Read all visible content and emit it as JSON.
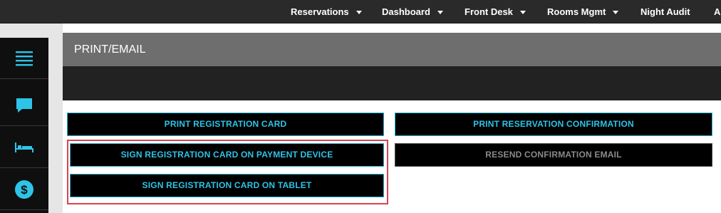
{
  "nav": {
    "items": [
      {
        "label": "Reservations",
        "dropdown": true
      },
      {
        "label": "Dashboard",
        "dropdown": true
      },
      {
        "label": "Front Desk",
        "dropdown": true
      },
      {
        "label": "Rooms Mgmt",
        "dropdown": true
      },
      {
        "label": "Night Audit",
        "dropdown": false
      },
      {
        "label": "A",
        "dropdown": false
      }
    ]
  },
  "sidebar": {
    "icons": [
      "menu-icon",
      "chat-icon",
      "bed-icon",
      "dollar-icon"
    ]
  },
  "panel": {
    "title": "PRINT/EMAIL",
    "buttons": {
      "print_registration_card": "PRINT REGISTRATION CARD",
      "sign_on_payment_device": "SIGN REGISTRATION CARD ON PAYMENT DEVICE",
      "sign_on_tablet": "SIGN REGISTRATION CARD ON TABLET",
      "print_reservation_confirmation": "PRINT RESERVATION CONFIRMATION",
      "resend_confirmation_email": "RESEND CONFIRMATION EMAIL"
    }
  },
  "colors": {
    "accent": "#2ec4e8",
    "highlight": "#d9434e",
    "topbar": "#2a2a2a",
    "panel_header": "#6e6e6e"
  }
}
